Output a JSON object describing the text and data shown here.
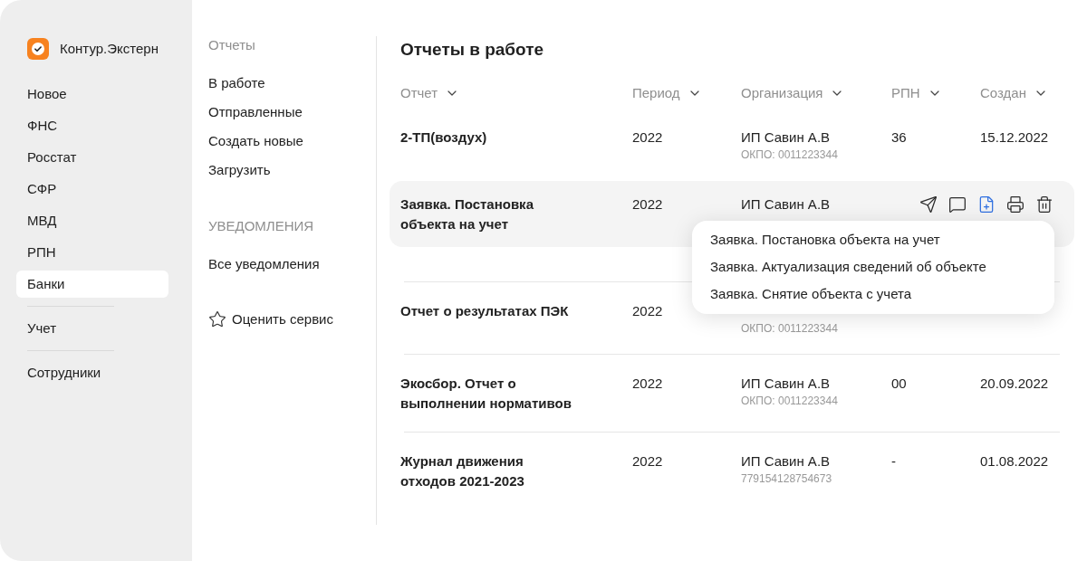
{
  "sidebar": {
    "logo_text": "Контур.Экстерн",
    "sections": [
      {
        "items": [
          {
            "label": "Новое",
            "selected": false
          },
          {
            "label": "ФНС",
            "selected": false
          },
          {
            "label": "Росстат",
            "selected": false
          },
          {
            "label": "СФР",
            "selected": false
          },
          {
            "label": "МВД",
            "selected": false
          },
          {
            "label": "РПН",
            "selected": false
          },
          {
            "label": "Банки",
            "selected": true
          }
        ]
      },
      {
        "items": [
          {
            "label": "Учет",
            "selected": false
          }
        ]
      },
      {
        "items": [
          {
            "label": "Сотрудники",
            "selected": false
          }
        ]
      }
    ]
  },
  "subnav": {
    "sections": [
      {
        "heading": "Отчеты",
        "items": [
          "В работе",
          "Отправленные",
          "Создать новые",
          "Загрузить"
        ]
      },
      {
        "heading": "УВЕДОМЛЕНИЯ",
        "items": [
          "Все уведомления"
        ]
      }
    ],
    "rate_link": "Оценить сервис"
  },
  "main": {
    "title": "Отчеты в работе",
    "table": {
      "columns": [
        "Отчет",
        "Период",
        "Организация",
        "РПН",
        "Создан"
      ],
      "rows": [
        {
          "report": "2-ТП(воздух)",
          "period": "2022",
          "organization": "ИП Савин А.В",
          "org_code": "ОКПО: 0011223344",
          "rpn": "36",
          "created": "15.12.2022",
          "hovered": false
        },
        {
          "report": "Заявка. Постановка объекта на учет",
          "period": "2022",
          "organization": "ИП Савин А.В",
          "hovered": true,
          "actions": [
            {
              "kind": "send",
              "active": false
            },
            {
              "kind": "comment",
              "active": false
            },
            {
              "kind": "add_document",
              "active": true
            },
            {
              "kind": "print",
              "active": false
            },
            {
              "kind": "delete",
              "active": false
            }
          ],
          "menu": {
            "items": [
              "Заявка. Постановка объекта на учет",
              "Заявка. Актуализация сведений об объекте",
              "Заявка. Снятие объекта с учета"
            ]
          }
        },
        {
          "report": "Отчет о результатах ПЭК",
          "period": "2022",
          "org_code": "ОКПО: 0011223344",
          "hovered": false
        },
        {
          "report": "Экосбор. Отчет о выполнении нормативов",
          "period": "2022",
          "organization": "ИП Савин А.В",
          "org_code": "ОКПО: 0011223344",
          "rpn": "00",
          "created": "20.09.2022",
          "hovered": false
        },
        {
          "report": "Журнал движения отходов 2021-2023",
          "period": "2022",
          "organization": "ИП Савин А.В",
          "org_code": "779154128754673",
          "rpn": "-",
          "created": "01.08.2022",
          "hovered": false
        }
      ]
    }
  }
}
